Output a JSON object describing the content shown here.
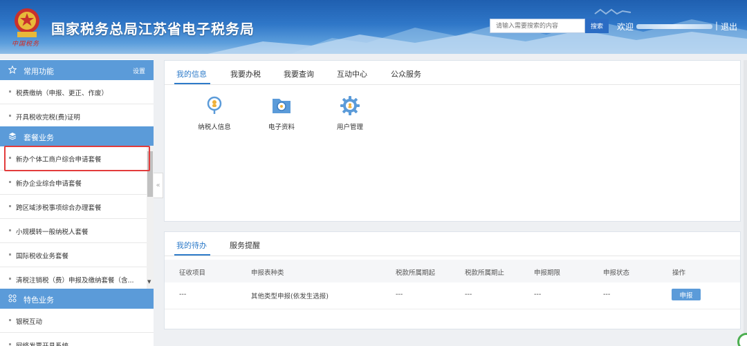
{
  "header": {
    "site_title": "国家税务总局江苏省电子税务局",
    "slogan": "中国税务",
    "search_placeholder": "请输入需要搜索的内容",
    "search_label": "搜索",
    "welcome_label": "欢迎",
    "separator": "|",
    "logout_label": "退出"
  },
  "sidebar": {
    "common": {
      "title": "常用功能",
      "settings_label": "设置",
      "items": [
        {
          "label": "税费缴纳（申报、更正、作废）"
        },
        {
          "label": "开具税收完税(费)证明"
        }
      ]
    },
    "package": {
      "title": "套餐业务",
      "items": [
        {
          "label": "新办个体工商户综合申请套餐"
        },
        {
          "label": "新办企业综合申请套餐"
        },
        {
          "label": "跨区域涉税事项综合办理套餐"
        },
        {
          "label": "小规模转一般纳税人套餐"
        },
        {
          "label": "国际税收业务套餐"
        },
        {
          "label": "清税注销税（费）申报及缴纳套餐（含..."
        }
      ]
    },
    "special": {
      "title": "特色业务",
      "items": [
        {
          "label": "银税互动"
        },
        {
          "label": "网络发票开具系统"
        }
      ]
    },
    "collapse_glyph": "«",
    "scroll_down_glyph": "▼"
  },
  "info_panel": {
    "tabs": [
      {
        "label": "我的信息"
      },
      {
        "label": "我要办税"
      },
      {
        "label": "我要查询"
      },
      {
        "label": "互动中心"
      },
      {
        "label": "公众服务"
      }
    ],
    "functions": [
      {
        "label": "纳税人信息",
        "icon": "taxpayer-info-icon"
      },
      {
        "label": "电子资料",
        "icon": "e-document-icon"
      },
      {
        "label": "用户管理",
        "icon": "user-management-icon"
      }
    ]
  },
  "todo_panel": {
    "tabs": [
      {
        "label": "我的待办"
      },
      {
        "label": "服务提醒"
      }
    ],
    "columns": [
      "征收项目",
      "申报表种类",
      "税款所属期起",
      "税款所属期止",
      "申报期限",
      "申报状态",
      "操作"
    ],
    "row": [
      "---",
      "其他类型申报(依发生选报)",
      "---",
      "---",
      "---",
      "---"
    ],
    "action_label": "申报"
  },
  "colors": {
    "accent": "#2e7bc9",
    "sidebar_header": "#5b9bd9",
    "highlight": "#e23b3b"
  }
}
